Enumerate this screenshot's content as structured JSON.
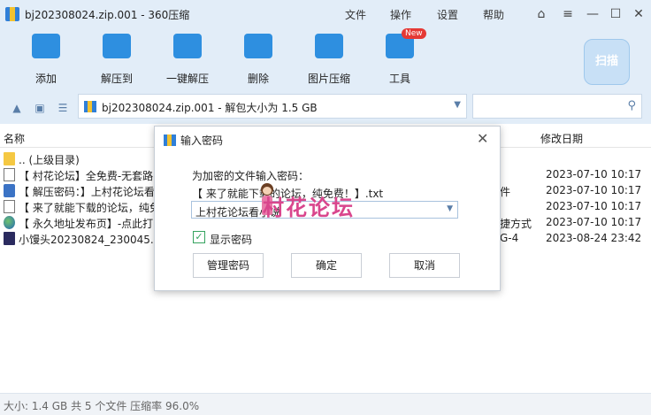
{
  "window": {
    "title": "bj202308024.zip.001 - 360压缩"
  },
  "menu": {
    "file": "文件",
    "operate": "操作",
    "settings": "设置",
    "help": "帮助"
  },
  "window_controls": {
    "skin": "⌂",
    "menu": "≡",
    "minimize": "—",
    "maximize": "☐",
    "close": "✕"
  },
  "toolbar": {
    "add": "添加",
    "extract_to": "解压到",
    "one_click_extract": "一键解压",
    "delete": "删除",
    "image_compress": "图片压缩",
    "tools": "工具",
    "new_badge": "New",
    "scan": "扫描"
  },
  "address": {
    "path": "bj202308024.zip.001 - 解包大小为 1.5 GB"
  },
  "columns": {
    "name": "名称",
    "modified": "修改日期"
  },
  "files": [
    {
      "name": ".. (上级目录)",
      "type": "",
      "date": "",
      "icon": "folder-icon"
    },
    {
      "name": "【 村花论坛】全免费-无套路",
      "type": "",
      "date": "2023-07-10 10:17",
      "icon": "text-file-icon"
    },
    {
      "name": "【 解压密码：】上村花论坛看",
      "type": "件",
      "date": "2023-07-10 10:17",
      "icon": "jpg-file-icon"
    },
    {
      "name": "【 来了就能下载的论坛，纯免",
      "type": "",
      "date": "2023-07-10 10:17",
      "icon": "text-file-icon"
    },
    {
      "name": "【 永久地址发布页】-点此打",
      "type": "捷方式",
      "date": "2023-07-10 10:17",
      "icon": "globe-icon"
    },
    {
      "name": "小馒头20230824_230045.m",
      "type": "G-4",
      "date": "2023-08-24 23:42",
      "icon": "mp4-file-icon"
    }
  ],
  "status": {
    "text": "大小: 1.4 GB 共 5 个文件 压缩率 96.0%"
  },
  "dialog": {
    "title": "输入密码",
    "close": "✕",
    "prompt": "为加密的文件输入密码：",
    "filename": "【 来了就能下载的论坛，纯免费！】.txt",
    "password": "上村花论坛看小说",
    "show_password_check": "✓",
    "show_password": "显示密码",
    "manage_button": "管理密码",
    "ok_button": "确定",
    "cancel_button": "取消"
  },
  "watermark": {
    "text": "村花论坛"
  },
  "colors": {
    "chrome": "#e2edf8",
    "accent": "#2e8fe0",
    "watermark": "#d9468d"
  }
}
